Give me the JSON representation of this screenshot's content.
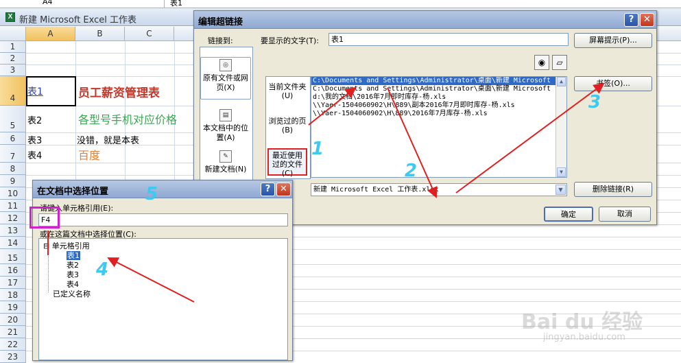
{
  "formula_bar": {
    "name_box": "A4",
    "formula": "表1"
  },
  "excel": {
    "title": "新建 Microsoft Excel 工作表",
    "columns": [
      "A",
      "B",
      "C"
    ],
    "rows": [
      "1",
      "2",
      "3",
      "4",
      "5",
      "6",
      "7",
      "8",
      "9",
      "10",
      "11",
      "12",
      "13",
      "14",
      "15",
      "16",
      "17",
      "18",
      "19",
      "20",
      "21",
      "22",
      "23"
    ],
    "cells": {
      "a4": "表1",
      "b4": "员工薪资管理表",
      "a5": "表2",
      "b5": "各型号手机对应价格",
      "a6": "表3",
      "b6": "没错，就是本表",
      "a7": "表4",
      "b7": "百度"
    },
    "colors": {
      "b4": "#c0392b",
      "b5": "#3aa653",
      "b7": "#e0823a"
    }
  },
  "hyperlink_dialog": {
    "title": "编辑超链接",
    "link_to_label": "链接到:",
    "display_text_label": "要显示的文字(T):",
    "display_text_value": "表1",
    "screentip_button": "屏幕提示(P)...",
    "nav_items": [
      "原有文件或网页(X)",
      "本文档中的位置(A)",
      "新建文档(N)"
    ],
    "sub_items": [
      "当前文件夹(U)",
      "浏览过的页(B)",
      "最近使用过的文件(C)"
    ],
    "files": [
      "C:\\Documents and Settings\\Administrator\\桌面\\新建 Microsoft",
      "C:\\Documents and Settings\\Administrator\\桌面\\新建 Microsoft",
      "d:\\我的文档\\2016年7月即时库存-杨.xls",
      "\\\\Yaer-1504060902\\H\\889\\副本2016年7月即时库存-杨.xls",
      "\\\\Yaer-1504060902\\H\\889\\2016年7月库存-杨.xls"
    ],
    "bookmark_button": "书签(O)...",
    "address_value": "新建 Microsoft Excel 工作表.xlsx",
    "remove_link_button": "删除链接(R)",
    "ok_button": "确定",
    "cancel_button": "取消"
  },
  "select_place_dialog": {
    "title": "在文档中选择位置",
    "cell_ref_label": "请键入单元格引用(E):",
    "cell_ref_value": "F4",
    "select_place_label": "或在这篇文档中选择位置(C):",
    "tree_root": "单元格引用",
    "sheets": [
      "表1",
      "表2",
      "表3",
      "表4"
    ],
    "defined_names": "已定义名称"
  },
  "annotations": [
    "1",
    "2",
    "3",
    "4",
    "5"
  ],
  "watermark": {
    "brand": "Bai du 经验",
    "url": "jingyan.baidu.com"
  },
  "annotation_color": "#40c8f0",
  "highlight_red": "#e02020",
  "highlight_magenta": "#d020d0"
}
